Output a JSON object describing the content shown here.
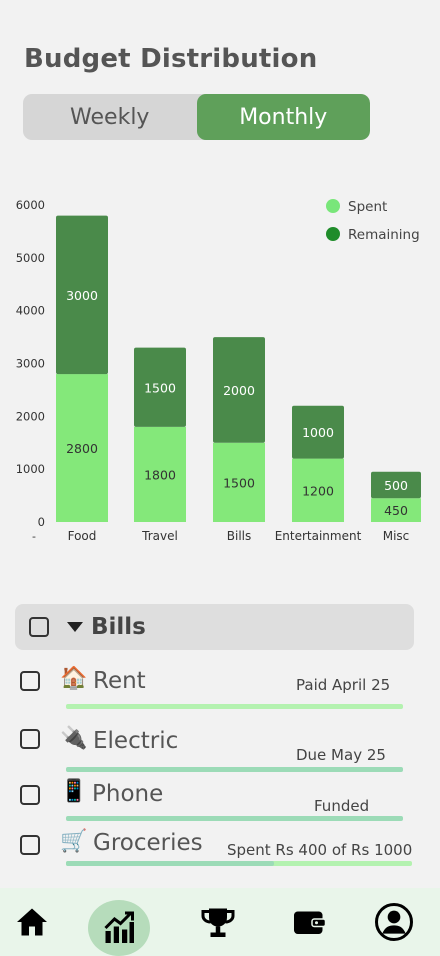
{
  "header": {
    "title": "Budget Distribution"
  },
  "toggle": {
    "weekly": "Weekly",
    "monthly": "Monthly",
    "selected": "Monthly"
  },
  "chart_data": {
    "type": "bar",
    "stacked": true,
    "categories": [
      "Food",
      "Travel",
      "Bills",
      "Entertainment",
      "Misc"
    ],
    "series": [
      {
        "name": "Spent",
        "values": [
          2800,
          1800,
          1500,
          1200,
          450
        ],
        "color": "#84e87a"
      },
      {
        "name": "Remaining",
        "values": [
          3000,
          1500,
          2000,
          1000,
          500
        ],
        "color": "#4a8a4a"
      }
    ],
    "ylim": [
      0,
      6000
    ],
    "yticks": [
      0,
      1000,
      2000,
      3000,
      4000,
      5000,
      6000
    ],
    "xlabel": "",
    "ylabel": "",
    "legend_position": "top-right",
    "legend_marker_colors": [
      "#79e67a",
      "#1f8c2a"
    ]
  },
  "group": {
    "label": "Bills"
  },
  "items": [
    {
      "icon": "house-icon",
      "emoji": "🏠",
      "name": "Rent",
      "status": "Paid April 25",
      "progress": 1.0,
      "bar_color": "#b4f2b0"
    },
    {
      "icon": "plug-icon",
      "emoji": "🔌",
      "name": "Electric",
      "status": "Due May 25",
      "progress": 1.0,
      "bar_color": "#9cdbb7"
    },
    {
      "icon": "phone-icon",
      "emoji": "📱",
      "name": "Phone",
      "status": "Funded",
      "progress": 1.0,
      "bar_color": "#9cdbb7"
    },
    {
      "icon": "cart-icon",
      "emoji": "🛒",
      "name": "Groceries",
      "status": "Spent Rs 400 of Rs 1000",
      "progress": 0.6,
      "bar_color": "#9cdbb7",
      "bar_remaining_color": "#b4f2b0"
    }
  ],
  "nav": [
    {
      "name": "home-icon"
    },
    {
      "name": "stats-icon",
      "active": true
    },
    {
      "name": "trophy-icon"
    },
    {
      "name": "wallet-icon"
    },
    {
      "name": "profile-icon"
    }
  ]
}
